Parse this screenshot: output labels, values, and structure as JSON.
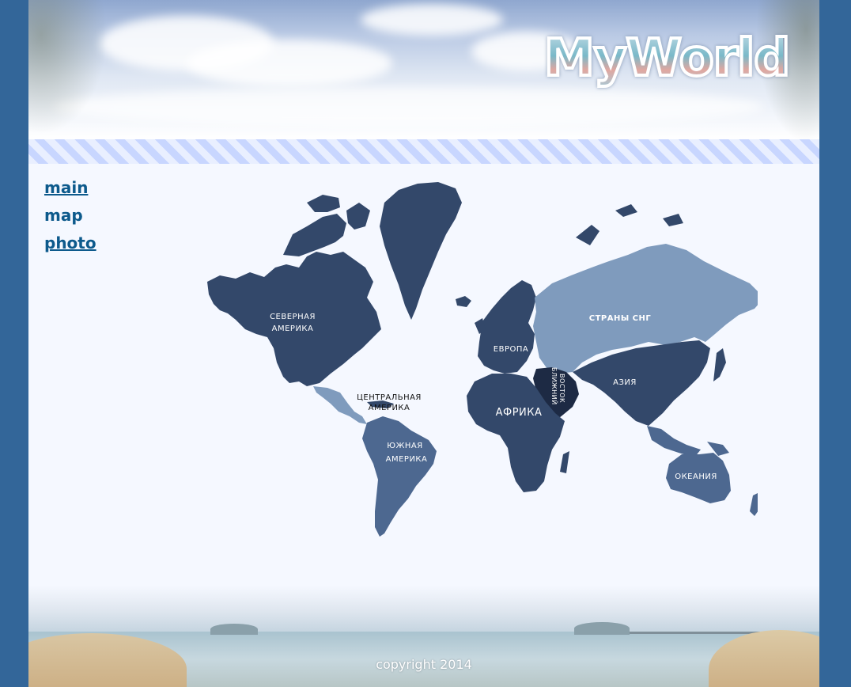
{
  "header": {
    "logo_text": "MyWorld"
  },
  "nav": {
    "items": [
      {
        "label": "main",
        "linked": true
      },
      {
        "label": "map",
        "linked": false
      },
      {
        "label": "photo",
        "linked": true
      }
    ]
  },
  "map": {
    "regions": {
      "north_america": [
        "СЕВЕРНАЯ",
        "АМЕРИКА"
      ],
      "central_america": [
        "ЦЕНТРАЛЬНАЯ",
        "АМЕРИКА"
      ],
      "south_america": [
        "ЮЖНАЯ",
        "АМЕРИКА"
      ],
      "europe": "ЕВРОПА",
      "cis": "СТРАНЫ СНГ",
      "middle_east": [
        "БЛИЖНИЙ",
        "ВОСТОК"
      ],
      "africa": "АФРИКА",
      "asia": "АЗИЯ",
      "oceania": "ОКЕАНИЯ"
    },
    "colors": {
      "dark": "#33486a",
      "medium": "#4d6890",
      "light": "#7f9bbd",
      "middle_east": "#1d2a44"
    }
  },
  "footer": {
    "copyright": "copyright 2014"
  }
}
